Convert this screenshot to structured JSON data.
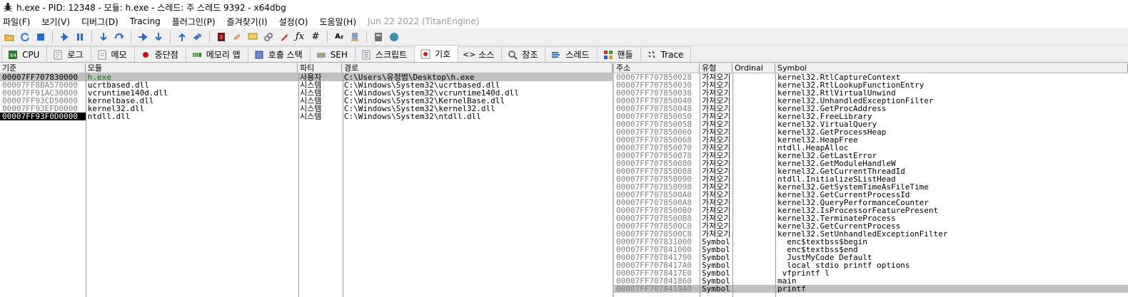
{
  "title": "h.exe - PID: 12348 - 모듈: h.exe - 스레드: 주 스레드 9392 - x64dbg",
  "menu": [
    "파일(F)",
    "보기(V)",
    "디버그(D)",
    "Tracing",
    "플러그인(P)",
    "즐겨찾기(I)",
    "설정(O)",
    "도움말(H)"
  ],
  "menu_date": "Jun 22 2022 (TitanEngine)",
  "tabs": [
    {
      "label": "CPU",
      "icon": "cpu-icon",
      "active": false
    },
    {
      "label": "로그",
      "icon": "log-icon",
      "active": false
    },
    {
      "label": "메모",
      "icon": "notes-icon",
      "active": false
    },
    {
      "label": "중단점",
      "icon": "breakpoint-icon",
      "active": false
    },
    {
      "label": "메모리 맵",
      "icon": "memory-map-icon",
      "active": false
    },
    {
      "label": "호출 스택",
      "icon": "call-stack-icon",
      "active": false
    },
    {
      "label": "SEH",
      "icon": "seh-icon",
      "active": false
    },
    {
      "label": "스크립트",
      "icon": "script-icon",
      "active": false
    },
    {
      "label": "기호",
      "icon": "symbols-icon",
      "active": true
    },
    {
      "label": "소스",
      "icon": "source-icon",
      "active": false
    },
    {
      "label": "참조",
      "icon": "references-icon",
      "active": false
    },
    {
      "label": "스레드",
      "icon": "threads-icon",
      "active": false
    },
    {
      "label": "핸들",
      "icon": "handles-icon",
      "active": false
    },
    {
      "label": "Trace",
      "icon": "trace-icon",
      "active": false
    }
  ],
  "modules": {
    "headers": [
      "기준",
      "모듈",
      "파티",
      "경로"
    ],
    "rows": [
      {
        "base": "00007FF707830000",
        "module": "h.exe",
        "party": "사용자",
        "path": "C:\\Users\\유정범\\Desktop\\h.exe"
      },
      {
        "base": "00007FF8BA570000",
        "module": "ucrtbased.dll",
        "party": "시스템",
        "path": "C:\\Windows\\System32\\ucrtbased.dll"
      },
      {
        "base": "00007FF91AC30000",
        "module": "vcruntime140d.dll",
        "party": "시스템",
        "path": "C:\\Windows\\System32\\vcruntime140d.dll"
      },
      {
        "base": "00007FF93CD50000",
        "module": "kernelbase.dll",
        "party": "시스템",
        "path": "C:\\Windows\\System32\\KernelBase.dll"
      },
      {
        "base": "00007FF93EFD0000",
        "module": "kernel32.dll",
        "party": "시스템",
        "path": "C:\\Windows\\System32\\kernel32.dll"
      },
      {
        "base": "00007FF93F0D0000",
        "module": "ntdll.dll",
        "party": "시스템",
        "path": "C:\\Windows\\System32\\ntdll.dll"
      }
    ]
  },
  "symbols": {
    "headers": [
      "주소",
      "유형",
      "Ordinal",
      "Symbol"
    ],
    "rows": [
      {
        "addr": "00007FF707850028",
        "type": "가져오기",
        "ord": "",
        "sym": "kernel32.RtlCaptureContext"
      },
      {
        "addr": "00007FF707850030",
        "type": "가져오기",
        "ord": "",
        "sym": "kernel32.RtlLookupFunctionEntry"
      },
      {
        "addr": "00007FF707850038",
        "type": "가져오기",
        "ord": "",
        "sym": "kernel32.RtlVirtualUnwind"
      },
      {
        "addr": "00007FF707850040",
        "type": "가져오기",
        "ord": "",
        "sym": "kernel32.UnhandledExceptionFilter"
      },
      {
        "addr": "00007FF707850048",
        "type": "가져오기",
        "ord": "",
        "sym": "kernel32.GetProcAddress"
      },
      {
        "addr": "00007FF707850050",
        "type": "가져오기",
        "ord": "",
        "sym": "kernel32.FreeLibrary"
      },
      {
        "addr": "00007FF707850058",
        "type": "가져오기",
        "ord": "",
        "sym": "kernel32.VirtualQuery"
      },
      {
        "addr": "00007FF707850060",
        "type": "가져오기",
        "ord": "",
        "sym": "kernel32.GetProcessHeap"
      },
      {
        "addr": "00007FF707850068",
        "type": "가져오기",
        "ord": "",
        "sym": "kernel32.HeapFree"
      },
      {
        "addr": "00007FF707850070",
        "type": "가져오기",
        "ord": "",
        "sym": "ntdll.HeapAlloc"
      },
      {
        "addr": "00007FF707850078",
        "type": "가져오기",
        "ord": "",
        "sym": "kernel32.GetLastError"
      },
      {
        "addr": "00007FF707850080",
        "type": "가져오기",
        "ord": "",
        "sym": "kernel32.GetModuleHandleW"
      },
      {
        "addr": "00007FF707850088",
        "type": "가져오기",
        "ord": "",
        "sym": "kernel32.GetCurrentThreadId"
      },
      {
        "addr": "00007FF707850090",
        "type": "가져오기",
        "ord": "",
        "sym": "ntdll.InitializeSListHead"
      },
      {
        "addr": "00007FF707850098",
        "type": "가져오기",
        "ord": "",
        "sym": "kernel32.GetSystemTimeAsFileTime"
      },
      {
        "addr": "00007FF7078500A0",
        "type": "가져오기",
        "ord": "",
        "sym": "kernel32.GetCurrentProcessId"
      },
      {
        "addr": "00007FF7078500A8",
        "type": "가져오기",
        "ord": "",
        "sym": "kernel32.QueryPerformanceCounter"
      },
      {
        "addr": "00007FF7078500B0",
        "type": "가져오기",
        "ord": "",
        "sym": "kernel32.IsProcessorFeaturePresent"
      },
      {
        "addr": "00007FF7078500B8",
        "type": "가져오기",
        "ord": "",
        "sym": "kernel32.TerminateProcess"
      },
      {
        "addr": "00007FF7078500C0",
        "type": "가져오기",
        "ord": "",
        "sym": "kernel32.GetCurrentProcess"
      },
      {
        "addr": "00007FF7078500C8",
        "type": "가져오기",
        "ord": "",
        "sym": "kernel32.SetUnhandledExceptionFilter"
      },
      {
        "addr": "00007FF707831000",
        "type": "Symbol",
        "ord": "",
        "sym": "__enc$textbss$begin"
      },
      {
        "addr": "00007FF707841000",
        "type": "Symbol",
        "ord": "",
        "sym": "__enc$textbss$end"
      },
      {
        "addr": "00007FF707841790",
        "type": "Symbol",
        "ord": "",
        "sym": "__JustMyCode_Default"
      },
      {
        "addr": "00007FF7078417A0",
        "type": "Symbol",
        "ord": "",
        "sym": "__local_stdio_printf_options"
      },
      {
        "addr": "00007FF7078417E0",
        "type": "Symbol",
        "ord": "",
        "sym": "_vfprintf_l"
      },
      {
        "addr": "00007FF707841860",
        "type": "Symbol",
        "ord": "",
        "sym": "main"
      },
      {
        "addr": "00007FF7078418A0",
        "type": "Symbol",
        "ord": "",
        "sym": "printf"
      }
    ]
  },
  "colors": {
    "selected": "#c0c0c0",
    "current": "#000000",
    "module_green": "#008000"
  }
}
